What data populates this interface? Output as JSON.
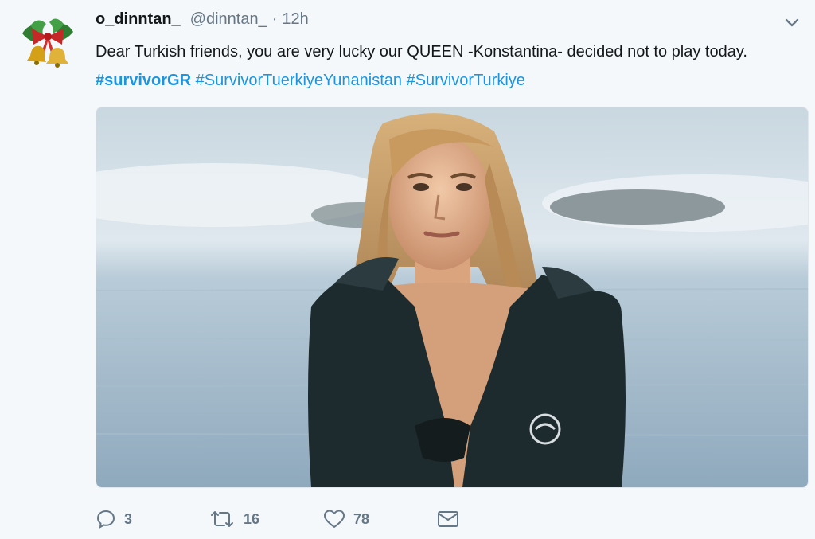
{
  "tweet": {
    "author": {
      "display_name": "o_dinntan_",
      "handle": "@dinntan_",
      "separator": "·",
      "time": "12h",
      "avatar_icon": "christmas-bells-icon"
    },
    "text_parts": {
      "line": "Dear Turkish friends, you are very lucky our QUEEN -Konstantina- decided not to play today.",
      "hashtag_1": "#survivorGR",
      "hashtag_2": "#SurvivorTuerkiyeYunanistan",
      "hashtag_3": "#SurvivorTurkiye"
    },
    "actions": {
      "reply_count": "3",
      "retweet_count": "16",
      "like_count": "78",
      "reply_icon": "reply-icon",
      "retweet_icon": "retweet-icon",
      "like_icon": "heart-icon",
      "message_icon": "envelope-icon"
    }
  },
  "colors": {
    "text": "#14171a",
    "muted": "#657786",
    "link": "#1b95e0",
    "background": "#f5f8fa"
  }
}
